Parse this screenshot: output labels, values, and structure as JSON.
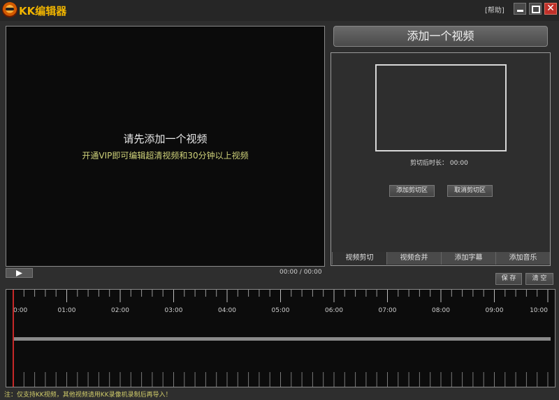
{
  "app": {
    "title": "KK编辑器",
    "help": "[帮助]",
    "close_glyph": "✕"
  },
  "preview": {
    "message": "请先添加一个视频",
    "vip_notice": "开通VIP即可编辑超清视频和30分钟以上视频",
    "time": "00:00 / 00:00"
  },
  "right_panel": {
    "add_video": "添加一个视频",
    "clip_duration": "剪切后时长： 00:00",
    "add_clip": "添加剪切区",
    "cancel_clip": "取消剪切区",
    "tabs": [
      "视频剪切",
      "视频合并",
      "添加字幕",
      "添加音乐"
    ],
    "save": "保 存",
    "clear": "清 空"
  },
  "timeline": {
    "ticks": [
      "0:00",
      "01:00",
      "02:00",
      "03:00",
      "04:00",
      "05:00",
      "06:00",
      "07:00",
      "08:00",
      "09:00",
      "10:00"
    ]
  },
  "footer": {
    "note": "注：仅支持KK视频，其他视频请用KK录像机录制后再导入！"
  },
  "colors": {
    "accent": "#f0b400",
    "playhead": "#c62828",
    "vip_text": "#cfd27a"
  }
}
